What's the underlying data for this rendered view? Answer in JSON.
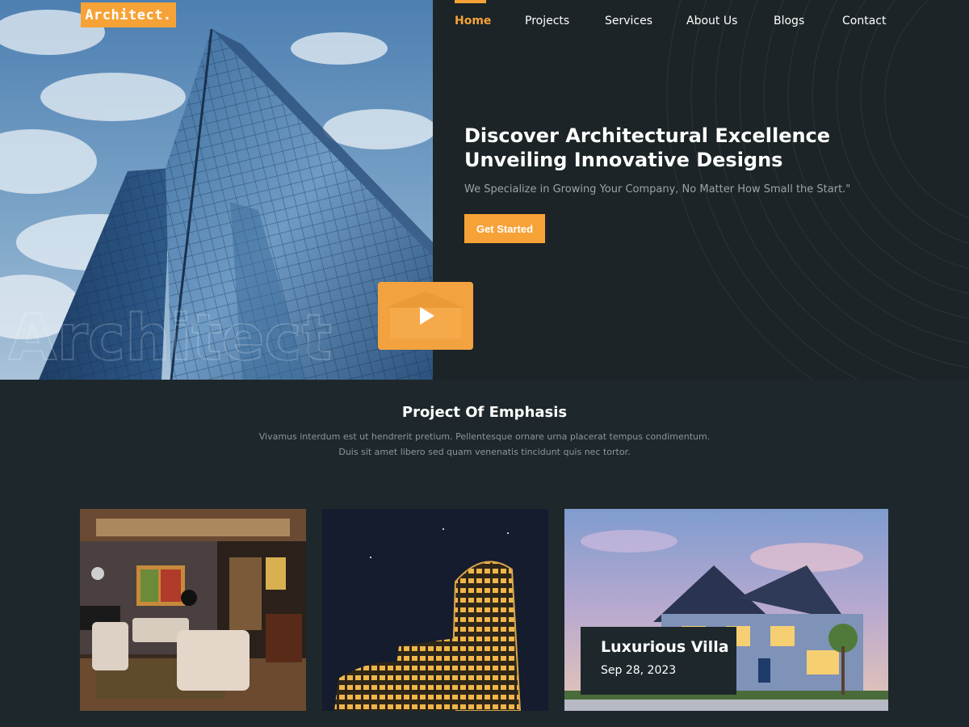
{
  "brand": {
    "logo_text": "Architect.",
    "accent": "#f7a237",
    "background": "#1e282c"
  },
  "nav": {
    "items": [
      {
        "label": "Home",
        "active": true
      },
      {
        "label": "Projects",
        "active": false
      },
      {
        "label": "Services",
        "active": false
      },
      {
        "label": "About Us",
        "active": false
      },
      {
        "label": "Blogs",
        "active": false
      },
      {
        "label": "Contact",
        "active": false
      }
    ]
  },
  "hero": {
    "title": "Discover Architectural Excellence Unveiling Innovative Designs",
    "subtitle": "We Specialize in Growing Your Company, No Matter How Small the Start.\"",
    "cta_label": "Get Started",
    "image_watermark": "Architect",
    "video_icon": "play-icon"
  },
  "projects": {
    "title": "Project Of Emphasis",
    "description_lines": [
      "Vivamus interdum est ut hendrerit pretium. Pellentesque ornare urna placerat tempus condimentum.",
      "Duis sit amet libero sed quam venenatis tincidunt quis nec tortor."
    ],
    "cards": [
      {
        "image": "living-room-interior"
      },
      {
        "image": "curved-building-night"
      },
      {
        "image": "luxury-villa-dusk",
        "title": "Luxurious Villa",
        "date": "Sep 28, 2023"
      }
    ]
  }
}
